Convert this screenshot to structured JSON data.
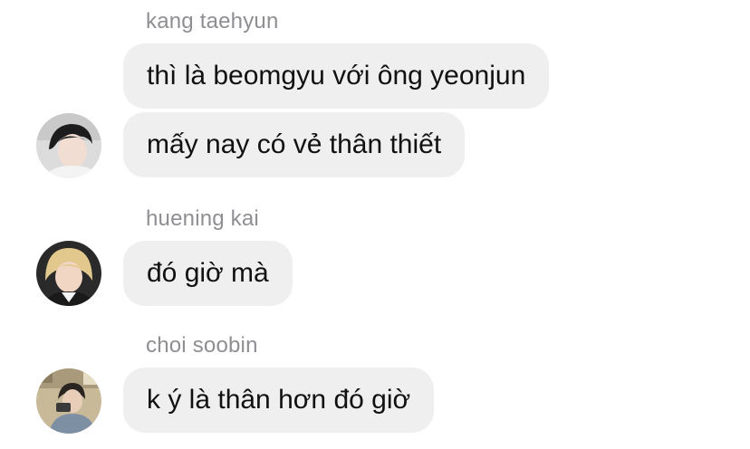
{
  "messages": [
    {
      "sender": "kang taehyun",
      "bubbles": [
        "thì là beomgyu với ông yeonjun",
        "mấy nay có vẻ thân thiết"
      ],
      "avatar": "taehyun-avatar"
    },
    {
      "sender": "huening kai",
      "bubbles": [
        "đó giờ mà"
      ],
      "avatar": "kai-avatar"
    },
    {
      "sender": "choi soobin",
      "bubbles": [
        "k ý là thân hơn đó giờ"
      ],
      "avatar": "soobin-avatar"
    }
  ],
  "colors": {
    "bubble_bg": "#efefef",
    "sender_text": "#8e8e93",
    "message_text": "#111111"
  }
}
